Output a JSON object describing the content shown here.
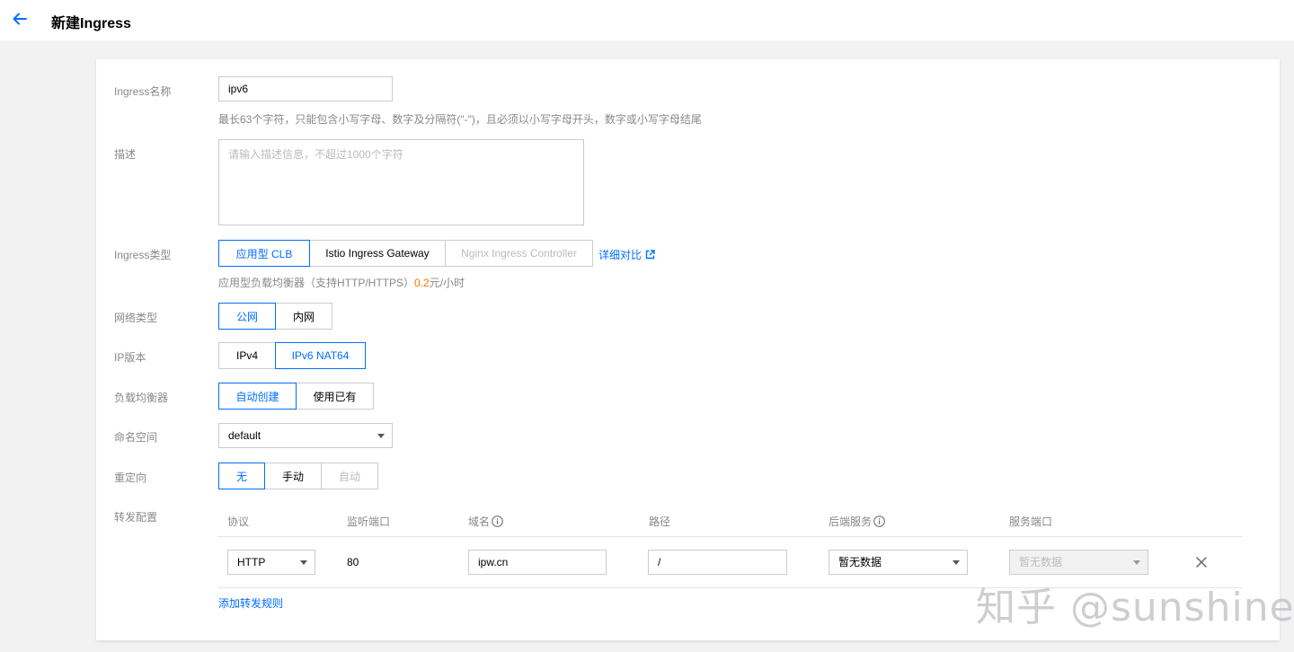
{
  "header": {
    "title": "新建Ingress"
  },
  "form": {
    "name": {
      "label": "Ingress名称",
      "value": "ipv6",
      "hint": "最长63个字符，只能包含小写字母、数字及分隔符(\"-\")，且必须以小写字母开头，数字或小写字母结尾"
    },
    "description": {
      "label": "描述",
      "placeholder": "请输入描述信息，不超过1000个字符"
    },
    "ingress_type": {
      "label": "Ingress类型",
      "options": [
        "应用型 CLB",
        "Istio Ingress Gateway",
        "Nginx Ingress Controller"
      ],
      "compare_link": "详细对比",
      "hint_prefix": "应用型负载均衡器（支持HTTP/HTTPS）",
      "hint_price": "0.2",
      "hint_suffix": "元/小时"
    },
    "network_type": {
      "label": "网络类型",
      "options": [
        "公网",
        "内网"
      ]
    },
    "ip_version": {
      "label": "IP版本",
      "options": [
        "IPv4",
        "IPv6 NAT64"
      ]
    },
    "load_balancer": {
      "label": "负载均衡器",
      "options": [
        "自动创建",
        "使用已有"
      ]
    },
    "namespace": {
      "label": "命名空间",
      "value": "default"
    },
    "redirect": {
      "label": "重定向",
      "options": [
        "无",
        "手动",
        "自动"
      ]
    },
    "forwarding": {
      "label": "转发配置",
      "columns": [
        "协议",
        "监听端口",
        "域名",
        "路径",
        "后端服务",
        "服务端口"
      ],
      "row": {
        "protocol": "HTTP",
        "port": "80",
        "domain": "ipw.cn",
        "path": "/",
        "backend": "暂无数据",
        "service_port": "暂无数据"
      },
      "add_link": "添加转发规则"
    }
  },
  "watermark": "知乎 @sunshine",
  "colors": {
    "accent": "#006eff",
    "price": "#ff7200"
  }
}
